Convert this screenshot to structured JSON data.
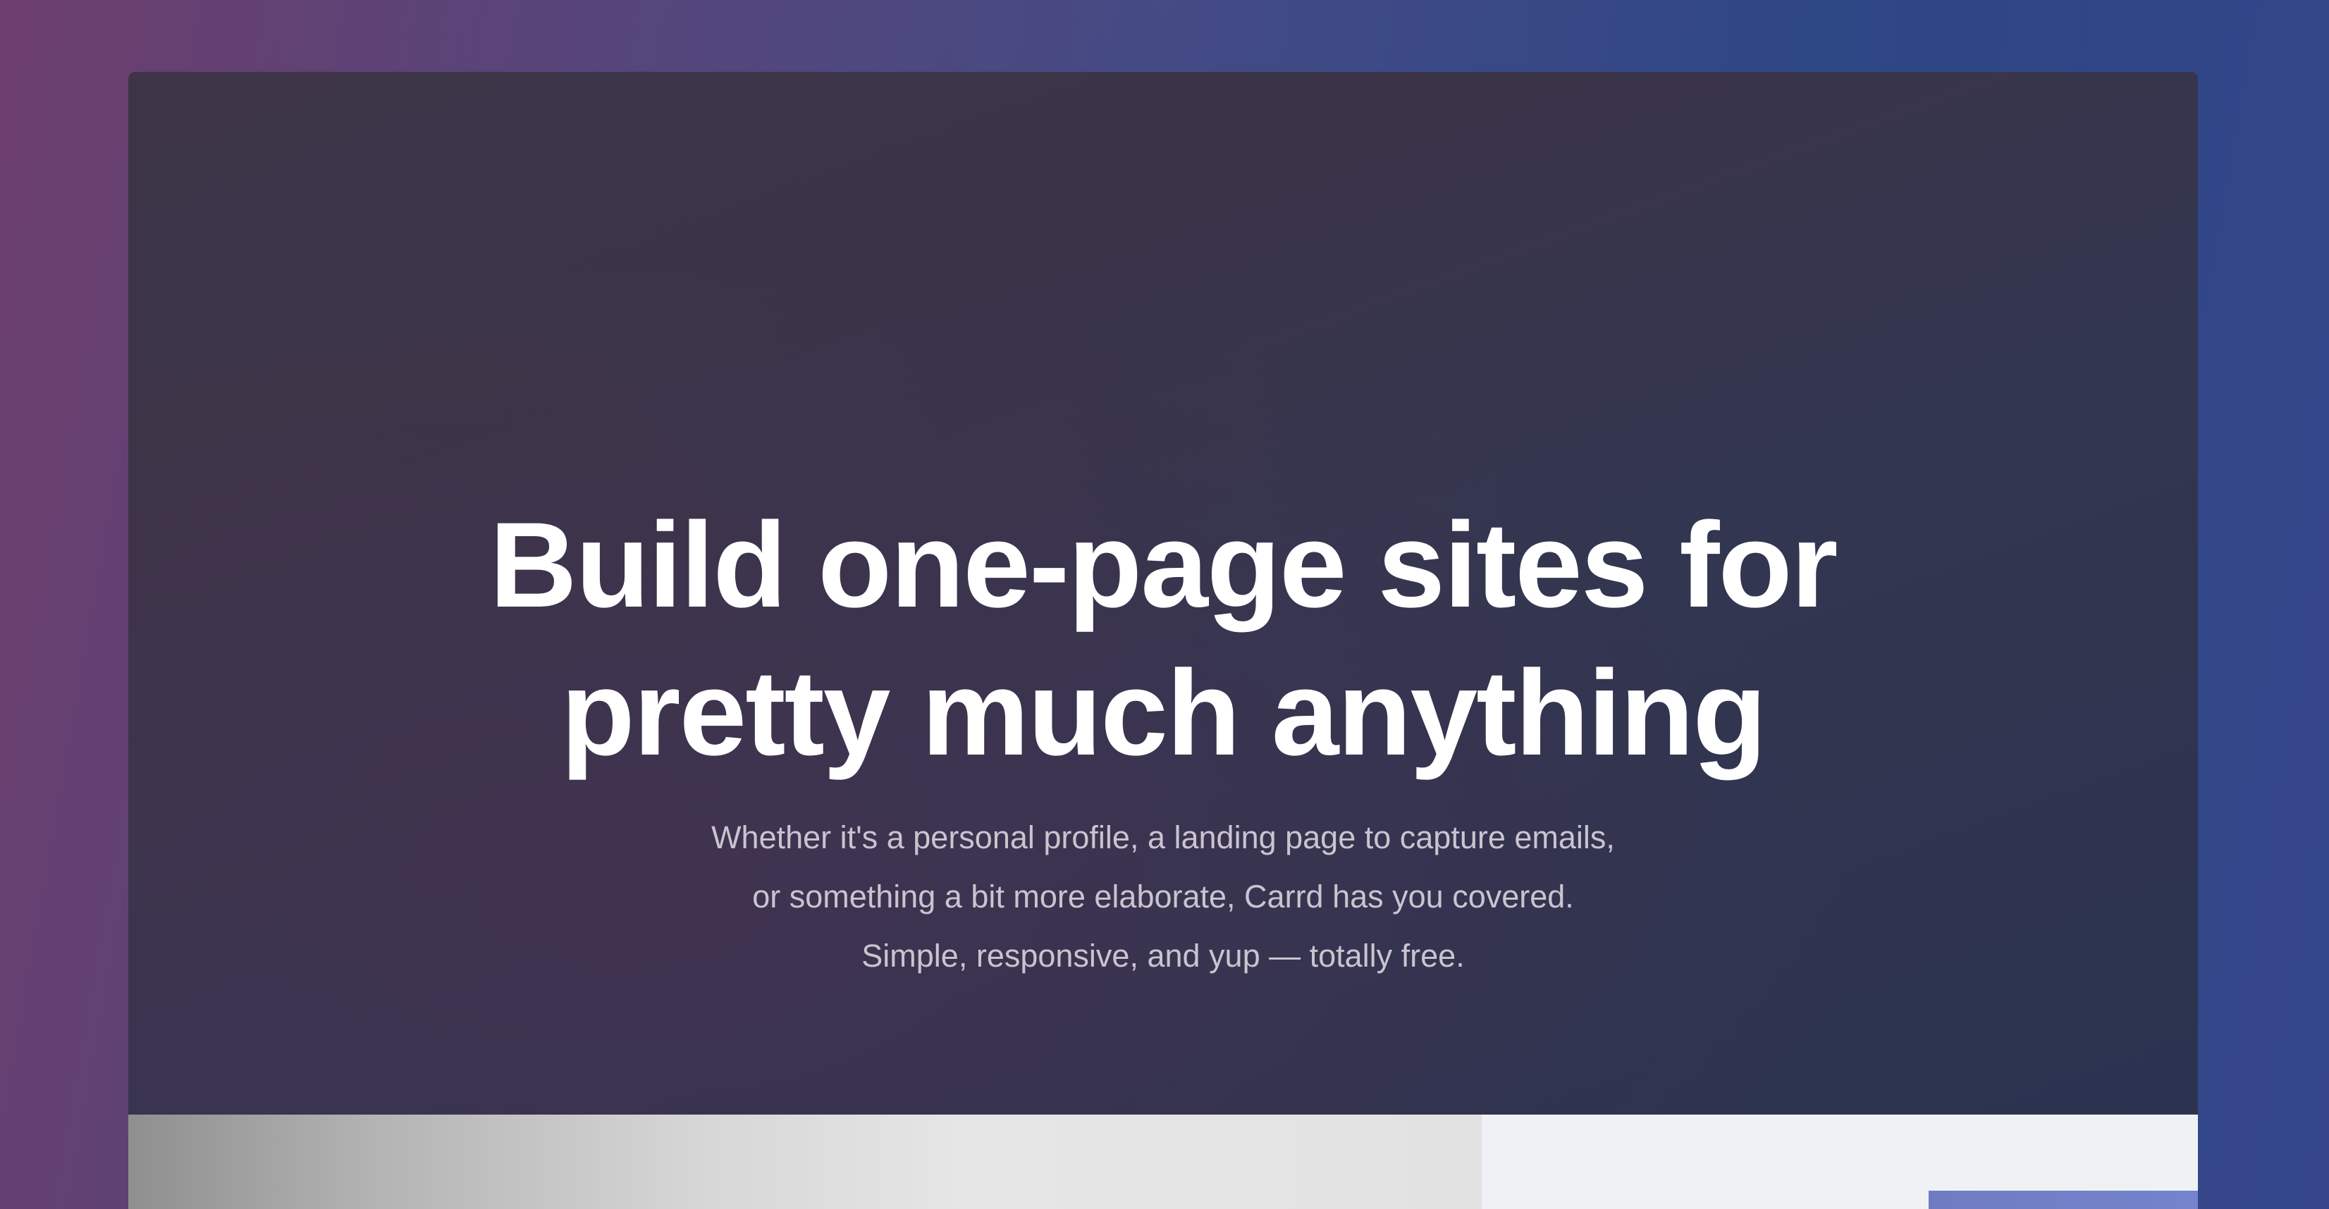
{
  "hero": {
    "title_line_1": "Build one-page sites for",
    "title_line_2": "pretty much anything",
    "subtitle_line_1": "Whether it's a personal profile, a landing page to capture emails,",
    "subtitle_line_2": "or something a bit more elaborate, Carrd has you covered.",
    "subtitle_line_3": "Simple, responsive, and yup — totally free."
  },
  "colors": {
    "title": "#ffffff",
    "subtitle": "#c9c4cf",
    "card_background": "#35354c",
    "page_gradient_left": "#6d3f6e",
    "page_gradient_right": "#2c4584"
  }
}
